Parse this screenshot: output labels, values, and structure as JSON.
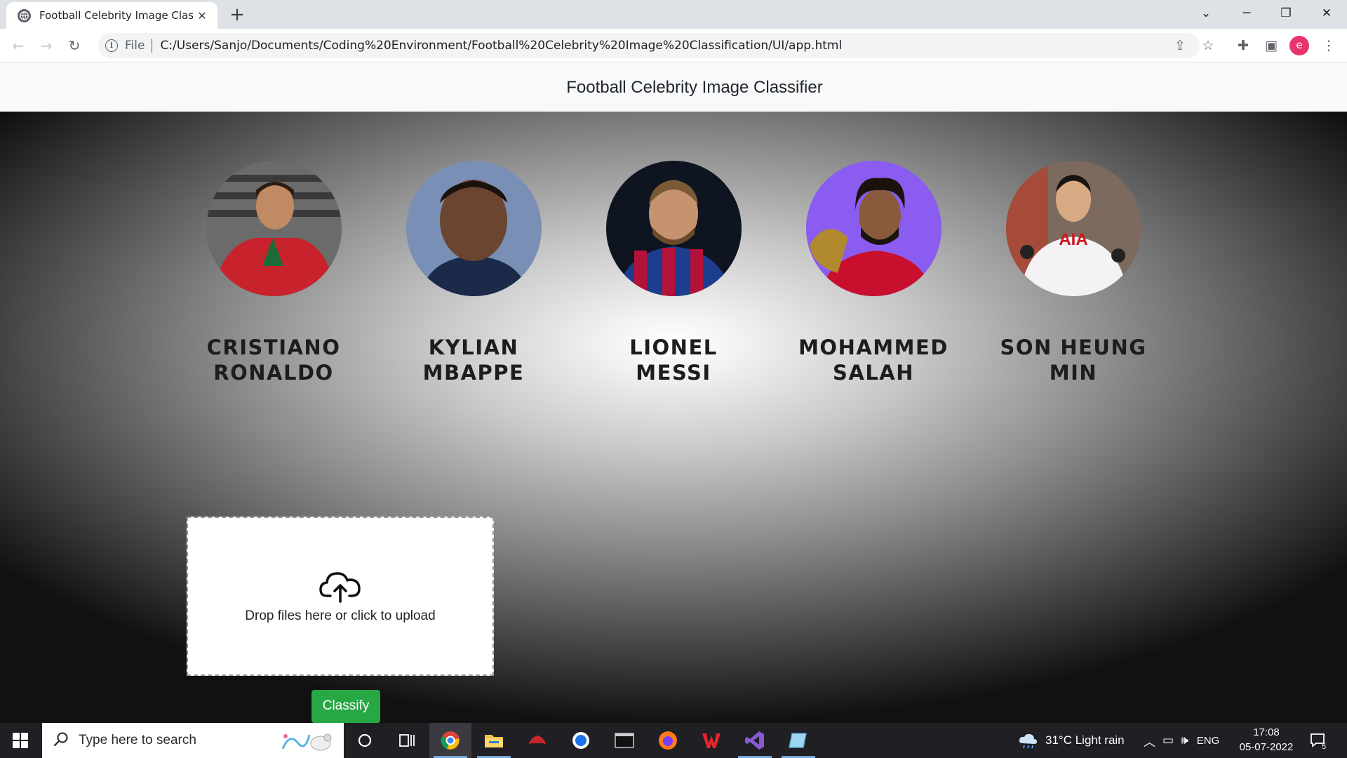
{
  "browser": {
    "tab_title": "Football Celebrity Image Classifie",
    "tab_close": "✕",
    "new_tab": "+",
    "url_scheme": "File",
    "url": "C:/Users/Sanjo/Documents/Coding%20Environment/Football%20Celebrity%20Image%20Classification/UI/app.html",
    "profile_initial": "e"
  },
  "page": {
    "brand": "Football Celebrity Image Classifier",
    "celebrities": [
      {
        "first": "CRISTIANO",
        "last": "RONALDO"
      },
      {
        "first": "KYLIAN",
        "last": "MBAPPE"
      },
      {
        "first": "LIONEL",
        "last": "MESSI"
      },
      {
        "first": "MOHAMMED",
        "last": "SALAH"
      },
      {
        "first": "SON HEUNG",
        "last": "MIN"
      }
    ],
    "dropzone_message": "Drop files here or click to upload",
    "classify_label": "Classify"
  },
  "taskbar": {
    "search_placeholder": "Type here to search",
    "weather": "31°C  Light rain",
    "language": "ENG",
    "time": "17:08",
    "date": "05-07-2022",
    "notification_count": "5"
  },
  "colors": {
    "classify_button": "#28a745",
    "navbar_bg": "#f8f9fa",
    "profile_avatar": "#e8336c"
  }
}
